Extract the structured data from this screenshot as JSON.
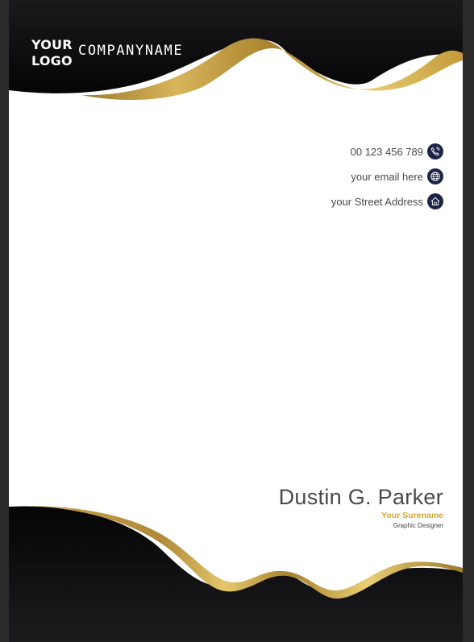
{
  "header": {
    "logo_line1": "YOUR",
    "logo_line2": "LOGO",
    "company_name": "COMPANYNAME"
  },
  "contact": {
    "phone": "00 123 456 789",
    "email": "your email here",
    "address": "your Street Address",
    "phone_icon": "phone-icon",
    "web_icon": "globe-icon",
    "address_icon": "home-icon"
  },
  "signature": {
    "name": "Dustin G. Parker",
    "surname": "Your Surename",
    "role": "Graphic Designer"
  },
  "colors": {
    "black": "#0b0b0d",
    "gold": "#d4a62a",
    "icon_bg": "#1e2447",
    "text": "#4a4a4a"
  }
}
